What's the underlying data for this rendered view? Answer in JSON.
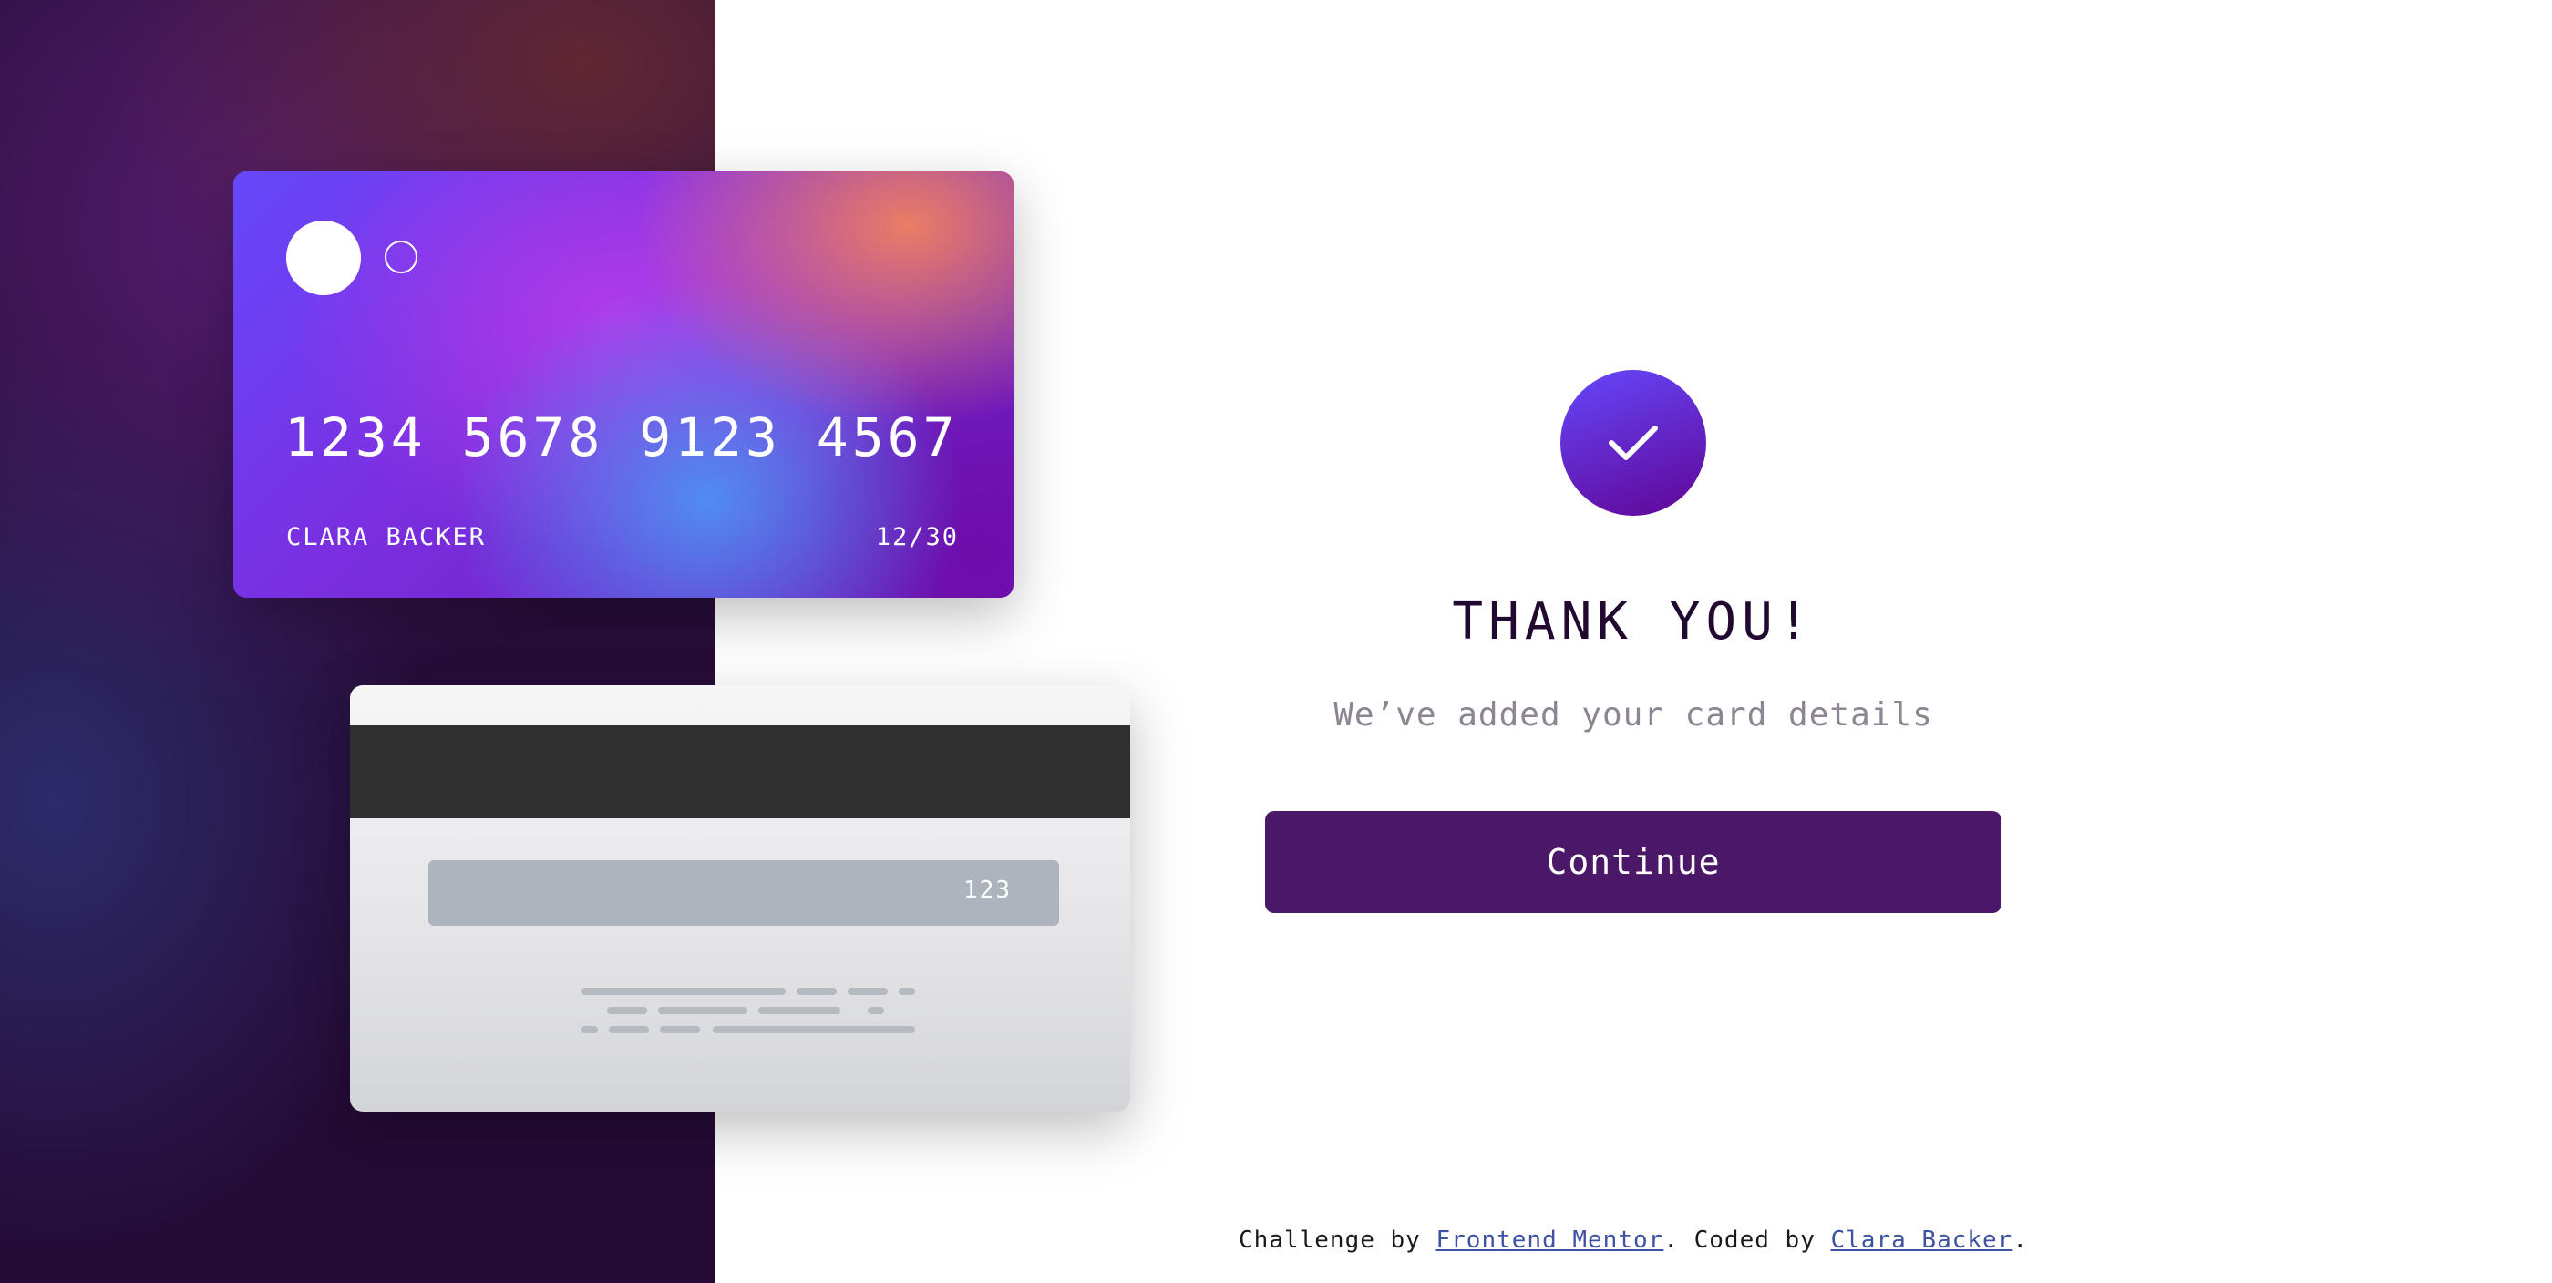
{
  "card_front": {
    "number": "1234 5678 9123 4567",
    "holder_name": "CLARA BACKER",
    "expiry": "12/30"
  },
  "card_back": {
    "cvc": "123"
  },
  "confirmation": {
    "icon": "check-icon",
    "title": "THANK YOU!",
    "subtitle": "We’ve added your card details",
    "continue_label": "Continue"
  },
  "footer": {
    "prefix": "Challenge by ",
    "challenge_link": "Frontend Mentor",
    "middle": ". Coded by ",
    "author_link": "Clara Backer",
    "suffix": "."
  },
  "colors": {
    "button_bg": "#4b1767",
    "title_text": "#21092f",
    "subtitle_text": "#8e8593",
    "link": "#3e52a3",
    "side_panel": "#240a34"
  }
}
